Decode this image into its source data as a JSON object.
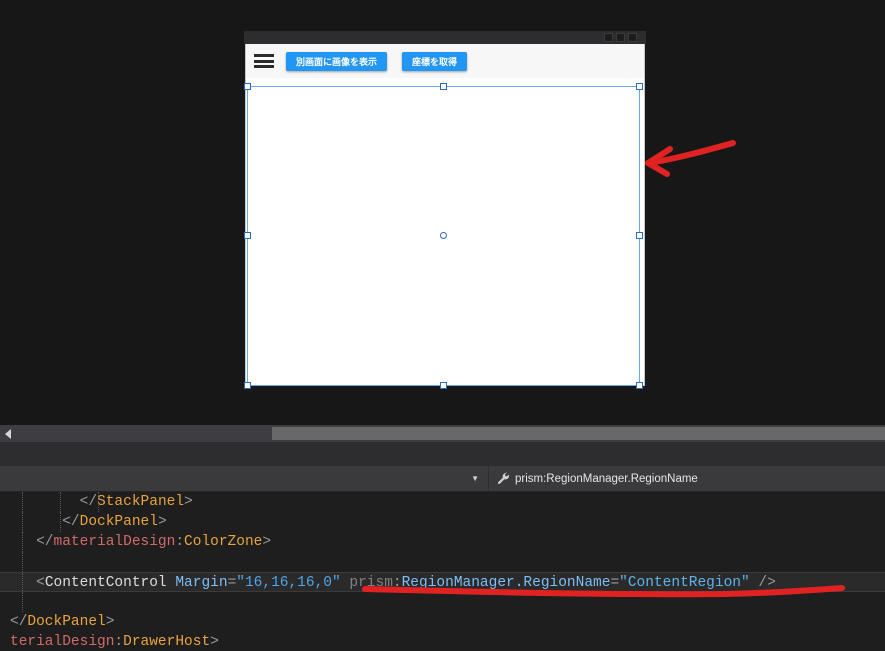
{
  "app": {
    "kind": "visual-studio-xaml-designer"
  },
  "preview_window": {
    "window_buttons": [
      "minimize-button",
      "maximize-button",
      "close-button"
    ],
    "menu_icon": "hamburger-icon",
    "buttons": [
      {
        "label": "別画面に画像を表示",
        "name": "show-image-in-separate-window-button"
      },
      {
        "label": "座標を取得",
        "name": "get-coordinates-button"
      }
    ],
    "accent_color": "#2196f3",
    "content_background": "#ffffff"
  },
  "selection": {
    "handle_color": "#2a6bbd",
    "border_color": "#6aa9e8"
  },
  "annotations": {
    "arrow_color": "#e02222",
    "underline_color": "#e02222"
  },
  "editor_topbar": {
    "member_dropdown_value": "",
    "property_icon": "wrench-icon",
    "property_name": "prism:RegionManager.RegionName"
  },
  "code": {
    "lines": [
      {
        "indent_guides": [
          22,
          60,
          98
        ],
        "tokens": [
          {
            "t": "        ",
            "c": "tok-punct"
          },
          {
            "t": "</",
            "c": "tok-punct"
          },
          {
            "t": "StackPanel",
            "c": "tok-tag"
          },
          {
            "t": ">",
            "c": "tok-punct"
          }
        ]
      },
      {
        "indent_guides": [
          22,
          60
        ],
        "tokens": [
          {
            "t": "      ",
            "c": "tok-punct"
          },
          {
            "t": "</",
            "c": "tok-punct"
          },
          {
            "t": "DockPanel",
            "c": "tok-tag"
          },
          {
            "t": ">",
            "c": "tok-punct"
          }
        ]
      },
      {
        "indent_guides": [
          22
        ],
        "tokens": [
          {
            "t": "   ",
            "c": "tok-punct"
          },
          {
            "t": "</",
            "c": "tok-punct"
          },
          {
            "t": "materialDesign",
            "c": "tok-tag2"
          },
          {
            "t": ":",
            "c": "tok-punct"
          },
          {
            "t": "ColorZone",
            "c": "tok-tag"
          },
          {
            "t": ">",
            "c": "tok-punct"
          }
        ]
      },
      {
        "indent_guides": [
          22
        ],
        "tokens": []
      },
      {
        "highlighted": true,
        "indent_guides": [
          22
        ],
        "tokens": [
          {
            "t": "   ",
            "c": "tok-punct"
          },
          {
            "t": "<",
            "c": "tok-punct"
          },
          {
            "t": "ContentControl",
            "c": "tok-name"
          },
          {
            "t": " ",
            "c": "tok-punct"
          },
          {
            "t": "Margin",
            "c": "tok-attr"
          },
          {
            "t": "=",
            "c": "tok-punct"
          },
          {
            "t": "\"16,16,16,0\"",
            "c": "tok-value"
          },
          {
            "t": " ",
            "c": "tok-punct"
          },
          {
            "t": "prism",
            "c": "tok-prefix"
          },
          {
            "t": ":",
            "c": "tok-punct"
          },
          {
            "t": "RegionManager.RegionName",
            "c": "tok-attr"
          },
          {
            "t": "=",
            "c": "tok-punct"
          },
          {
            "t": "\"ContentRegion\"",
            "c": "tok-str"
          },
          {
            "t": " ",
            "c": "tok-punct"
          },
          {
            "t": "/>",
            "c": "tok-punct"
          }
        ]
      },
      {
        "indent_guides": [
          22
        ],
        "tokens": []
      },
      {
        "indent_guides": [],
        "tokens": [
          {
            "t": "</",
            "c": "tok-punct"
          },
          {
            "t": "DockPanel",
            "c": "tok-tag"
          },
          {
            "t": ">",
            "c": "tok-punct"
          }
        ]
      },
      {
        "indent_guides": [],
        "tokens": [
          {
            "t": "terialDesign",
            "c": "tok-tag2"
          },
          {
            "t": ":",
            "c": "tok-punct"
          },
          {
            "t": "DrawerHost",
            "c": "tok-tag"
          },
          {
            "t": ">",
            "c": "tok-punct"
          }
        ]
      }
    ]
  }
}
